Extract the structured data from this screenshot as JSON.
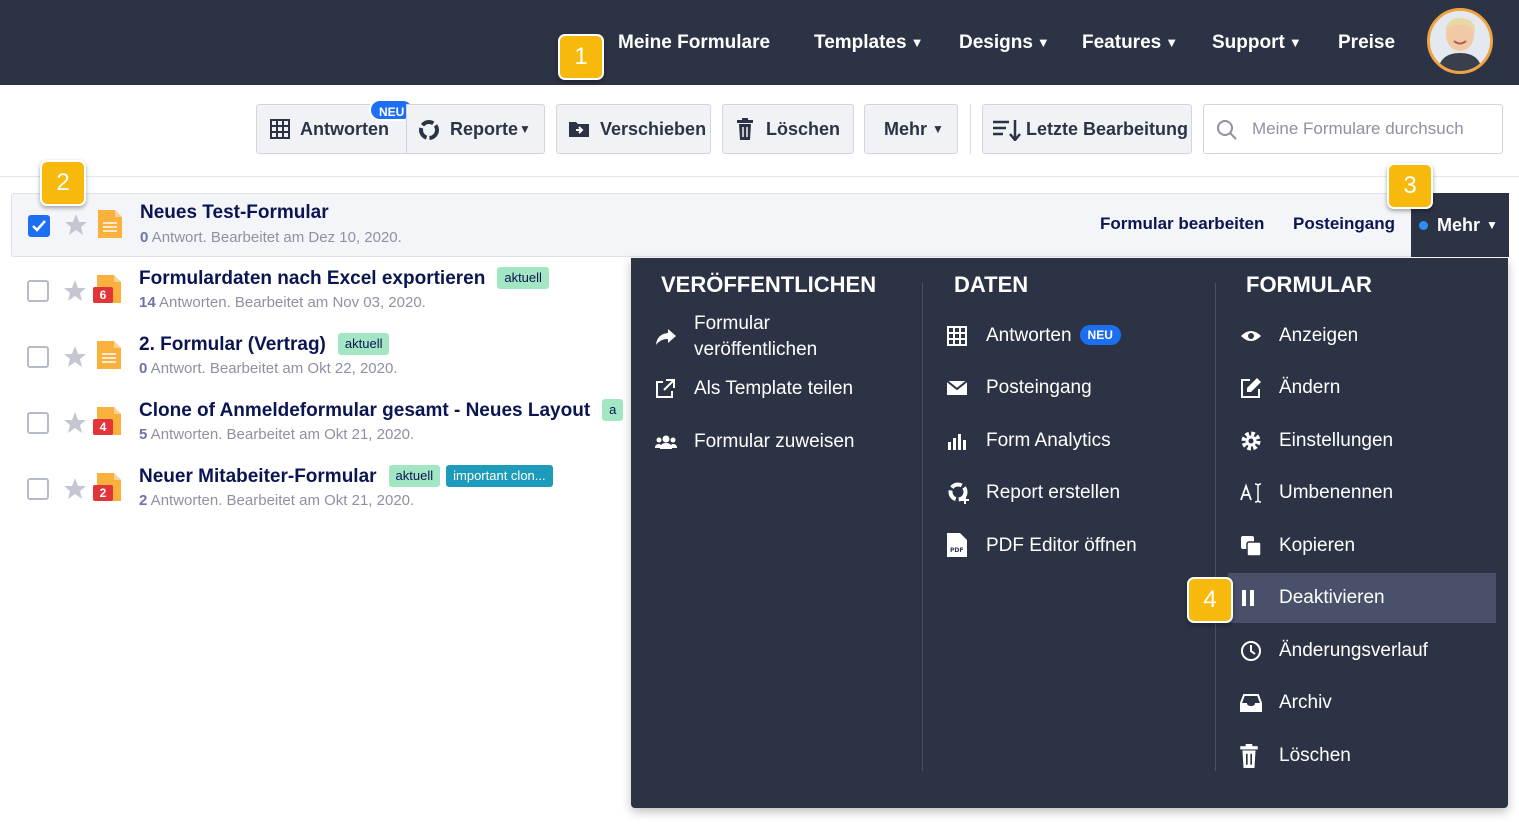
{
  "nav": {
    "items": [
      {
        "label": "Meine Formulare",
        "caret": false
      },
      {
        "label": "Templates",
        "caret": true
      },
      {
        "label": "Designs",
        "caret": true
      },
      {
        "label": "Features",
        "caret": true
      },
      {
        "label": "Support",
        "caret": true
      },
      {
        "label": "Preise",
        "caret": false
      }
    ],
    "caret_glyph": "▼",
    "avatar_icon": "user-avatar"
  },
  "callouts": [
    "1",
    "2",
    "3",
    "4"
  ],
  "toolbar": {
    "antworten": "Antworten",
    "neu_badge": "NEU",
    "reporte": "Reporte",
    "verschieben": "Verschieben",
    "loeschen": "Löschen",
    "mehr": "Mehr",
    "sort": "Letzte Bearbeitung",
    "search_placeholder": "Meine Formulare durchsuchen"
  },
  "forms": [
    {
      "title": "Neues Test-Formular",
      "count": "0",
      "meta": " Antwort. Bearbeitet am Dez 10, 2020.",
      "tags": [],
      "badge": "",
      "checked": true
    },
    {
      "title": "Formulardaten nach Excel exportieren",
      "count": "14",
      "meta": " Antworten. Bearbeitet am Nov 03, 2020.",
      "tags": [
        "aktuell"
      ],
      "badge": "6",
      "checked": false
    },
    {
      "title": "2. Formular (Vertrag)",
      "count": "0",
      "meta": " Antwort. Bearbeitet am Okt 22, 2020.",
      "tags": [
        "aktuell"
      ],
      "badge": "",
      "checked": false
    },
    {
      "title": "Clone of Anmeldeformular gesamt - Neues Layout",
      "count": "5",
      "meta": " Antworten. Bearbeitet am Okt 21, 2020.",
      "tags": [
        "a"
      ],
      "badge": "4",
      "checked": false
    },
    {
      "title": "Neuer Mitabeiter-Formular",
      "count": "2",
      "meta": " Antworten. Bearbeitet am Okt 21, 2020.",
      "tags": [
        "aktuell",
        "important clon..."
      ],
      "badge": "2",
      "checked": false
    }
  ],
  "row_actions": {
    "edit": "Formular bearbeiten",
    "inbox": "Posteingang",
    "more": "Mehr"
  },
  "dropdown": {
    "publish_heading": "VERÖFFENTLICHEN",
    "publish_items": [
      {
        "label_line1": "Formular",
        "label_line2": "veröffentlichen",
        "icon": "share-arrow-icon"
      },
      {
        "label": "Als Template teilen",
        "icon": "external-share-icon"
      },
      {
        "label": "Formular zuweisen",
        "icon": "users-icon"
      }
    ],
    "data_heading": "DATEN",
    "data_items": [
      {
        "label": "Antworten",
        "badge": "NEU",
        "icon": "table-grid-icon"
      },
      {
        "label": "Posteingang",
        "icon": "envelope-icon"
      },
      {
        "label": "Form Analytics",
        "icon": "bar-chart-icon"
      },
      {
        "label": "Report erstellen",
        "icon": "report-plus-icon"
      },
      {
        "label": "PDF Editor öffnen",
        "icon": "pdf-file-icon"
      }
    ],
    "form_heading": "FORMULAR",
    "form_items": [
      {
        "label": "Anzeigen",
        "icon": "eye-icon"
      },
      {
        "label": "Ändern",
        "icon": "edit-icon"
      },
      {
        "label": "Einstellungen",
        "icon": "gear-icon"
      },
      {
        "label": "Umbenennen",
        "icon": "rename-icon"
      },
      {
        "label": "Kopieren",
        "icon": "copy-icon"
      },
      {
        "label": "Deaktivieren",
        "icon": "pause-icon",
        "highlighted": true
      },
      {
        "label": "Änderungsverlauf",
        "icon": "clock-icon"
      },
      {
        "label": "Archiv",
        "icon": "archive-tray-icon"
      },
      {
        "label": "Löschen",
        "icon": "trash-icon"
      }
    ]
  },
  "colors": {
    "nav_bg": "#2c3345",
    "accent_blue": "#1c6ff2",
    "callout_yellow": "#f6b90c",
    "tag_green": "#a3e6c4",
    "tag_teal": "#1c9cba"
  }
}
